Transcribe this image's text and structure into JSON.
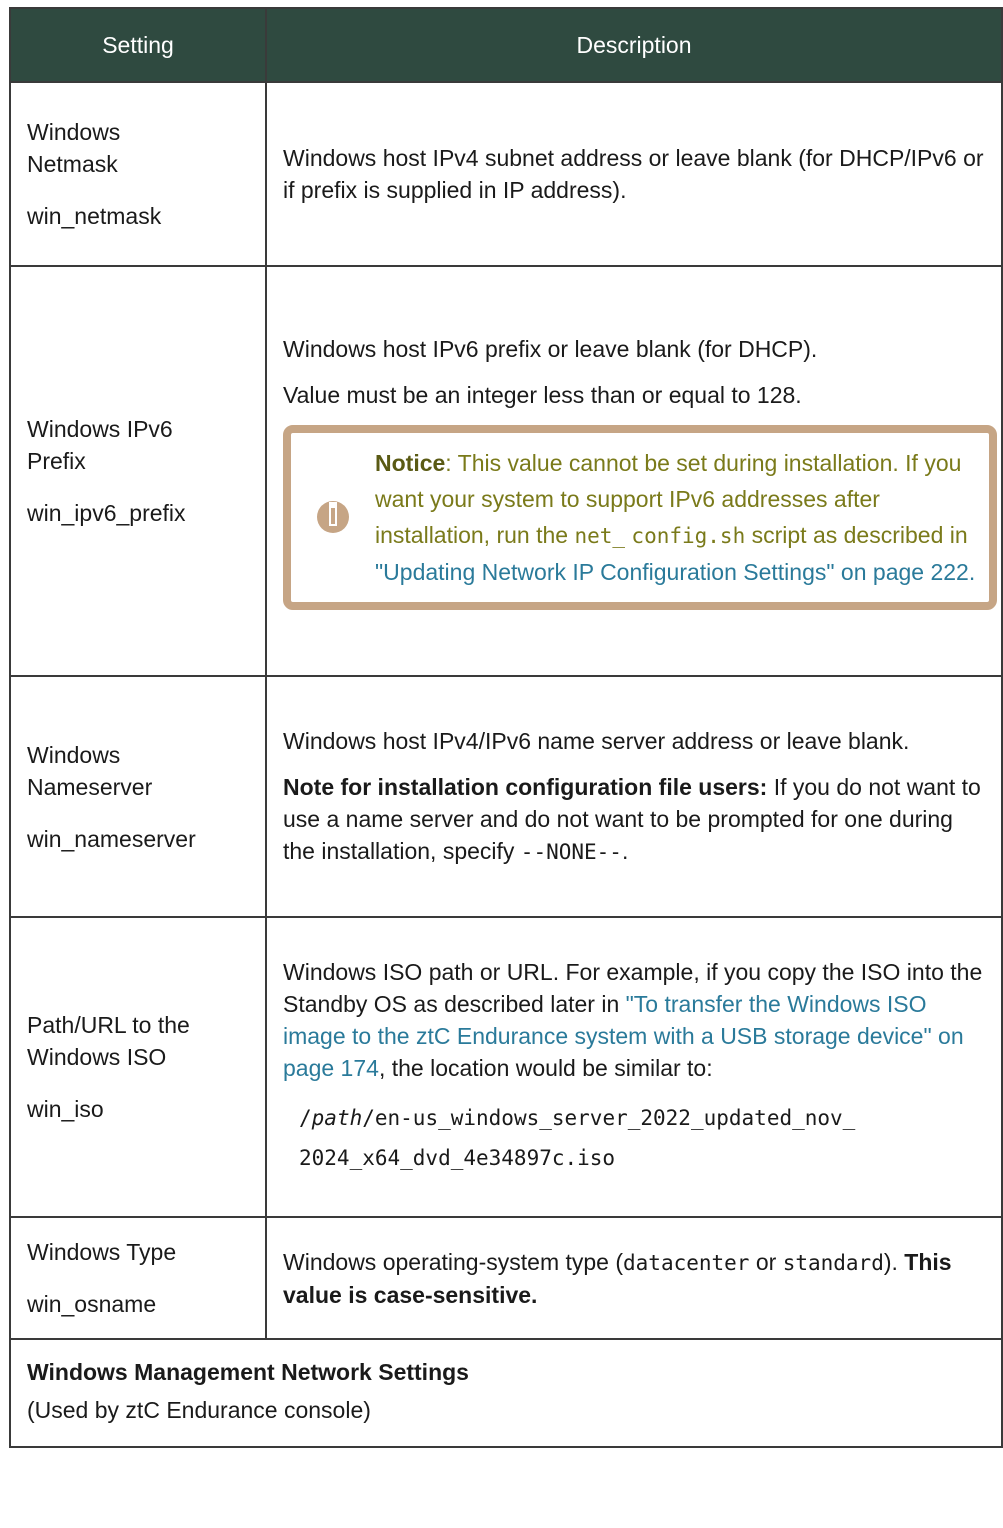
{
  "header": {
    "setting": "Setting",
    "description": "Description"
  },
  "rows": [
    {
      "name_lines": [
        "Windows",
        "Netmask"
      ],
      "code": "win_netmask",
      "desc": "Windows host IPv4 subnet address or leave blank (for DHCP/IPv6 or if prefix is supplied in IP address)."
    },
    {
      "name_lines": [
        "Windows IPv6",
        "Prefix"
      ],
      "code": "win_ipv6_prefix",
      "desc_p1": "Windows host IPv6 prefix or leave blank (for DHCP).",
      "desc_p2": "Value must be an integer less than or equal to 128.",
      "notice": {
        "label": "Notice",
        "text_before": ": This value cannot be set during installation. If you want your system to support IPv6 addresses after installation, run the ",
        "code1": "net_",
        "code2": "config.sh",
        "text_after": " script as described in ",
        "link": "\"Updating Network IP Configuration Settings\" on page 222",
        "end": "."
      }
    },
    {
      "name_lines": [
        "Windows",
        "Nameserver"
      ],
      "code": "win_nameserver",
      "desc_p1": "Windows host IPv4/IPv6 name server address or leave blank.",
      "note_label": "Note for installation configuration file users:",
      "note_text": " If you do not want to use a name server and do not want to be prompted for one during the installation, specify ",
      "note_code": "--NONE--",
      "note_end": "."
    },
    {
      "name_lines": [
        "Path/URL to the",
        "Windows ISO"
      ],
      "code": "win_iso",
      "desc_before": "Windows ISO path or URL. For example, if you copy the ISO into the Standby OS as described later in ",
      "desc_link": "\"To transfer the Windows ISO image to the ztC Endurance system with a USB storage device\" on page 174",
      "desc_after": ", the location would be similar to:",
      "path_italic": "path",
      "path_line1": "/en-us_windows_server_2022_updated_nov_",
      "path_line2": "2024_x64_dvd_4e34897c.iso"
    },
    {
      "name_lines": [
        "Windows Type"
      ],
      "code": "win_osname",
      "desc_before": "Windows operating-system type (",
      "code_a": "datacenter",
      "desc_mid": " or ",
      "code_b": "standard",
      "desc_after": "). ",
      "desc_bold": "This value is case-sensitive."
    }
  ],
  "section": {
    "title": "Windows Management Network Settings",
    "subtitle": "(Used by ztC Endurance console)"
  },
  "colors": {
    "header_bg": "#2f4a40",
    "notice_border": "#c6a585",
    "notice_text": "#7a7a1a",
    "link": "#2a7a9a"
  }
}
